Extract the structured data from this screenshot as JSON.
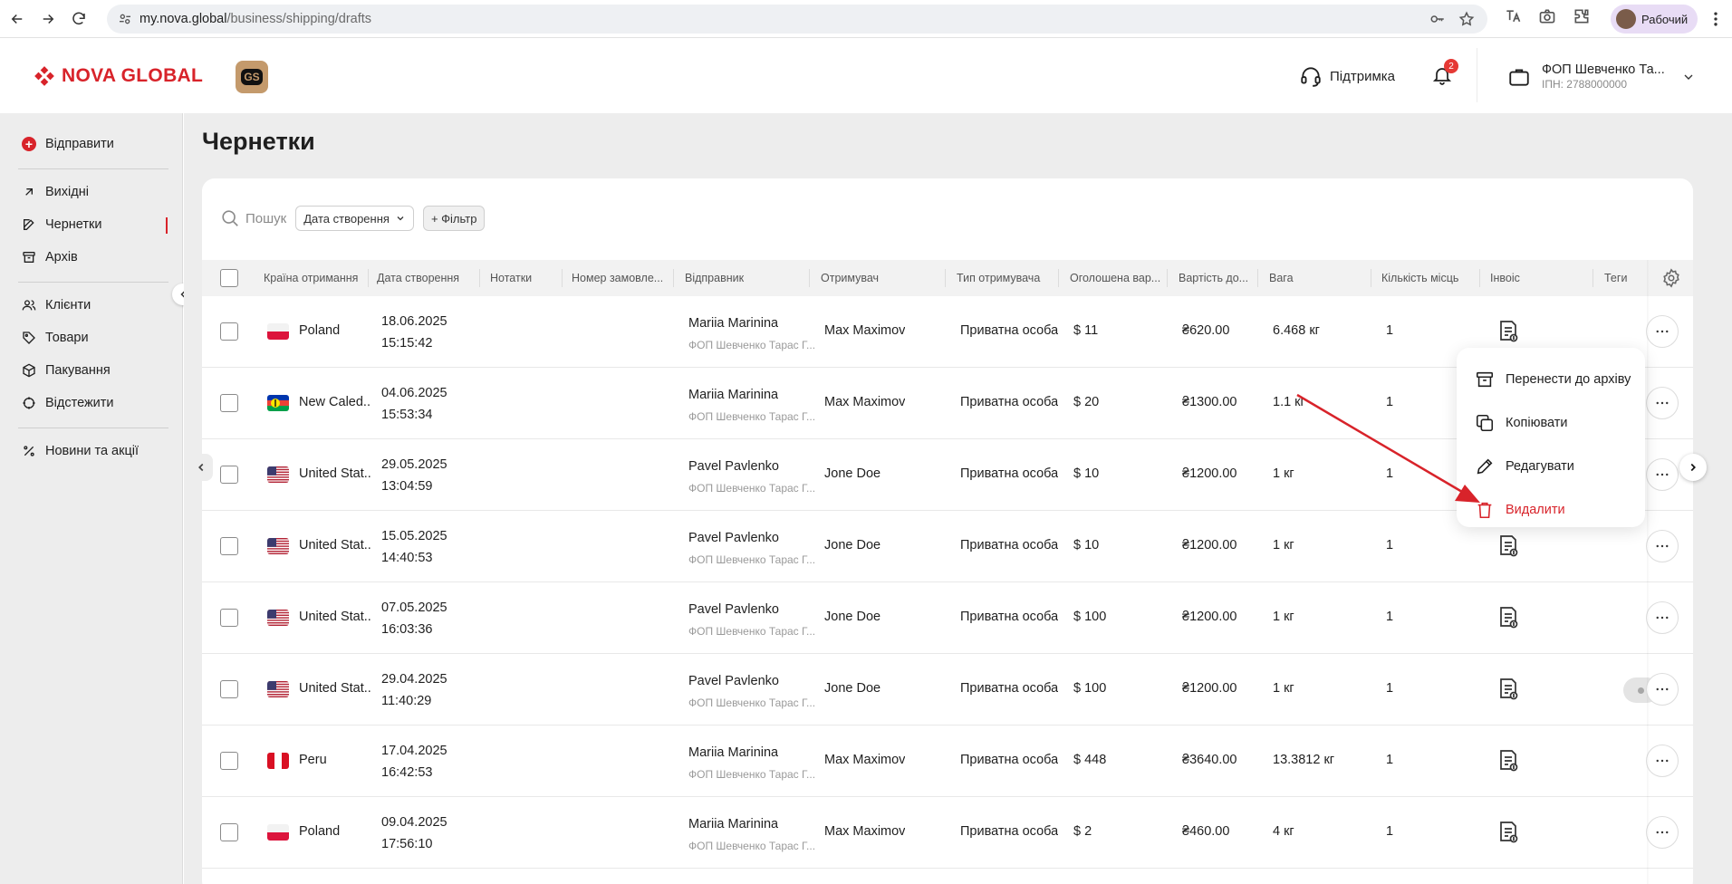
{
  "browser": {
    "url_host": "my.nova.global",
    "url_path": "/business/shipping/drafts",
    "profile_label": "Рабочий"
  },
  "header": {
    "logo_text": "NOVA GLOBAL",
    "badge_text": "GS",
    "support_label": "Підтримка",
    "notifications_count": "2",
    "account_name": "ФОП Шевченко Та...",
    "account_tax": "ІПН: 2788000000"
  },
  "sidebar": {
    "send_label": "Відправити",
    "items": [
      {
        "label": "Вихідні",
        "icon": "outgoing-arrow-icon"
      },
      {
        "label": "Чернетки",
        "icon": "edit-icon"
      },
      {
        "label": "Архів",
        "icon": "archive-icon"
      },
      {
        "label": "Клієнти",
        "icon": "clients-icon"
      },
      {
        "label": "Товари",
        "icon": "tag-icon"
      },
      {
        "label": "Пакування",
        "icon": "box-icon"
      },
      {
        "label": "Відстежити",
        "icon": "track-icon"
      },
      {
        "label": "Новини та акції",
        "icon": "percent-icon"
      }
    ]
  },
  "main": {
    "title": "Чернетки",
    "search_placeholder": "Пошук",
    "date_filter": "Дата створення",
    "add_filter": "+ Фільтр"
  },
  "table": {
    "columns": [
      "Країна отримання",
      "Дата створення",
      "Нотатки",
      "Номер замовле...",
      "Відправник",
      "Отримувач",
      "Тип отримувача",
      "Оголошена вар...",
      "Вартість до...",
      "Вага",
      "Кількість місць",
      "Інвоіс",
      "Теги"
    ],
    "rows": [
      {
        "country": "Poland",
        "flag": "poland",
        "date": "18.06.2025",
        "time": "15:15:42",
        "sender": "Mariia Marinina",
        "sender_sub": "ФОП Шевченко Тарас Г...",
        "recipient": "Max Maximov",
        "recipient_type": "Приватна особа",
        "declared": "$ 11",
        "cost": "₴620.00",
        "weight": "6.468 кг",
        "places": "1"
      },
      {
        "country": "New Caled...",
        "flag": "new-caledonia",
        "date": "04.06.2025",
        "time": "15:53:34",
        "sender": "Mariia Marinina",
        "sender_sub": "ФОП Шевченко Тарас Г...",
        "recipient": "Max Maximov",
        "recipient_type": "Приватна особа",
        "declared": "$ 20",
        "cost": "₴1300.00",
        "weight": "1.1 кг",
        "places": "1"
      },
      {
        "country": "United Stat...",
        "flag": "usa",
        "date": "29.05.2025",
        "time": "13:04:59",
        "sender": "Pavel Pavlenko",
        "sender_sub": "ФОП Шевченко Тарас Г...",
        "recipient": "Jone Doe",
        "recipient_type": "Приватна особа",
        "declared": "$ 10",
        "cost": "₴1200.00",
        "weight": "1 кг",
        "places": "1"
      },
      {
        "country": "United Stat...",
        "flag": "usa",
        "date": "15.05.2025",
        "time": "14:40:53",
        "sender": "Pavel Pavlenko",
        "sender_sub": "ФОП Шевченко Тарас Г...",
        "recipient": "Jone Doe",
        "recipient_type": "Приватна особа",
        "declared": "$ 10",
        "cost": "₴1200.00",
        "weight": "1 кг",
        "places": "1"
      },
      {
        "country": "United Stat...",
        "flag": "usa",
        "date": "07.05.2025",
        "time": "16:03:36",
        "sender": "Pavel Pavlenko",
        "sender_sub": "ФОП Шевченко Тарас Г...",
        "recipient": "Jone Doe",
        "recipient_type": "Приватна особа",
        "declared": "$ 100",
        "cost": "₴1200.00",
        "weight": "1 кг",
        "places": "1"
      },
      {
        "country": "United Stat...",
        "flag": "usa",
        "date": "29.04.2025",
        "time": "11:40:29",
        "sender": "Pavel Pavlenko",
        "sender_sub": "ФОП Шевченко Тарас Г...",
        "recipient": "Jone Doe",
        "recipient_type": "Приватна особа",
        "declared": "$ 100",
        "cost": "₴1200.00",
        "weight": "1 кг",
        "places": "1"
      },
      {
        "country": "Peru",
        "flag": "peru",
        "date": "17.04.2025",
        "time": "16:42:53",
        "sender": "Mariia Marinina",
        "sender_sub": "ФОП Шевченко Тарас Г...",
        "recipient": "Max Maximov",
        "recipient_type": "Приватна особа",
        "declared": "$ 448",
        "cost": "₴3640.00",
        "weight": "13.3812 кг",
        "places": "1"
      },
      {
        "country": "Poland",
        "flag": "poland",
        "date": "09.04.2025",
        "time": "17:56:10",
        "sender": "Mariia Marinina",
        "sender_sub": "ФОП Шевченко Тарас Г...",
        "recipient": "Max Maximov",
        "recipient_type": "Приватна особа",
        "declared": "$ 2",
        "cost": "₴460.00",
        "weight": "4 кг",
        "places": "1"
      }
    ]
  },
  "context_menu": {
    "archive": "Перенести до архіву",
    "copy": "Копіювати",
    "edit": "Редагувати",
    "delete": "Видалити"
  },
  "colors": {
    "brand_red": "#d8232a",
    "annotation_arrow": "#d8232a"
  }
}
